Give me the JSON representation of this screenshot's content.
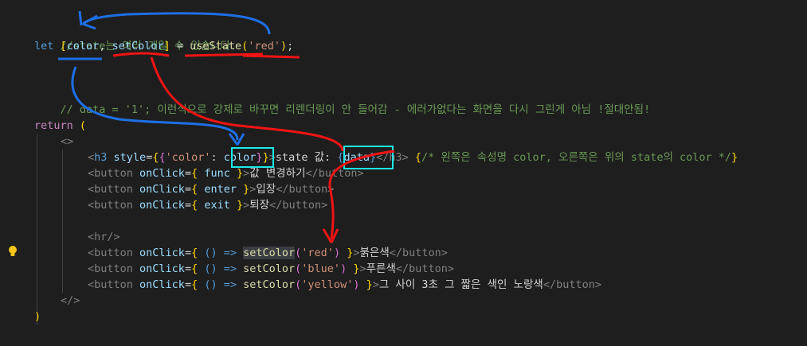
{
  "editor": {
    "lines": {
      "l1_comment": "//state는 여러 개일 수 있습니다.",
      "l2_let": "let",
      "l2_bracket_open": "[",
      "l2_color": "color",
      "l2_comma": ", ",
      "l2_setColor": "setColor",
      "l2_bracket_close": "]",
      "l2_eq": " = ",
      "l2_useState": "useState",
      "l2_paren_open": "(",
      "l2_red": "'red'",
      "l2_paren_close": ")",
      "l2_semi": ";",
      "l3_comment": "// data = '1'; 이런식으로 강제로 바꾸면 리렌더링이 안 들어감 - 에러가없다는 화면을 다시 그린게 아님 !절대안됨!",
      "l4_return": "return",
      "l4_paren": " (",
      "l5_frag_open": "<>",
      "l6_h3_open": "<h3",
      "l6_style": " style",
      "l6_eq": "=",
      "l6_brace1": "{",
      "l6_brace2": "{",
      "l6_color_key": "'color'",
      "l6_colon": ": ",
      "l6_color_val": "color",
      "l6_brace2c": "}",
      "l6_brace1c": "}",
      "l6_gt": ">",
      "l6_text": "state 값: ",
      "l6_data_open": "{",
      "l6_data": "data",
      "l6_data_close": "}",
      "l6_h3_close": "</h3>",
      "l6_comment_open": " {",
      "l6_comment": "/* 왼쪽은 속성명 color, 오른쪽은 위의 state의 color */",
      "l6_comment_close": "}",
      "l7_text": "값 변경하기",
      "l7_func": "func",
      "l8_text": "입장",
      "l8_func": "enter",
      "l9_text": "퇴장",
      "l9_func": "exit",
      "button_open": "<button",
      "onclick": " onClick",
      "eq": "=",
      "brace_open": "{ ",
      "brace_close": " }",
      "gt": ">",
      "button_close": "</button>",
      "l10_hr": "<hr/>",
      "arrow": "() => ",
      "setColor": "setColor",
      "red": "'red'",
      "blue": "'blue'",
      "yellow": "'yellow'",
      "l11_text": "붉은색",
      "l12_text": "푸른색",
      "l13_text": "그 사이 3초 그 짧은 색인 노랑색",
      "l14_frag_close": "</>",
      "l15_paren": ")"
    },
    "annotation_colors": {
      "blue_arrows": "#1e6fe6",
      "red_arrows": "#f01414",
      "highlight_boxes": "#1de9e9"
    },
    "icons": [
      "lightbulb-icon"
    ]
  }
}
